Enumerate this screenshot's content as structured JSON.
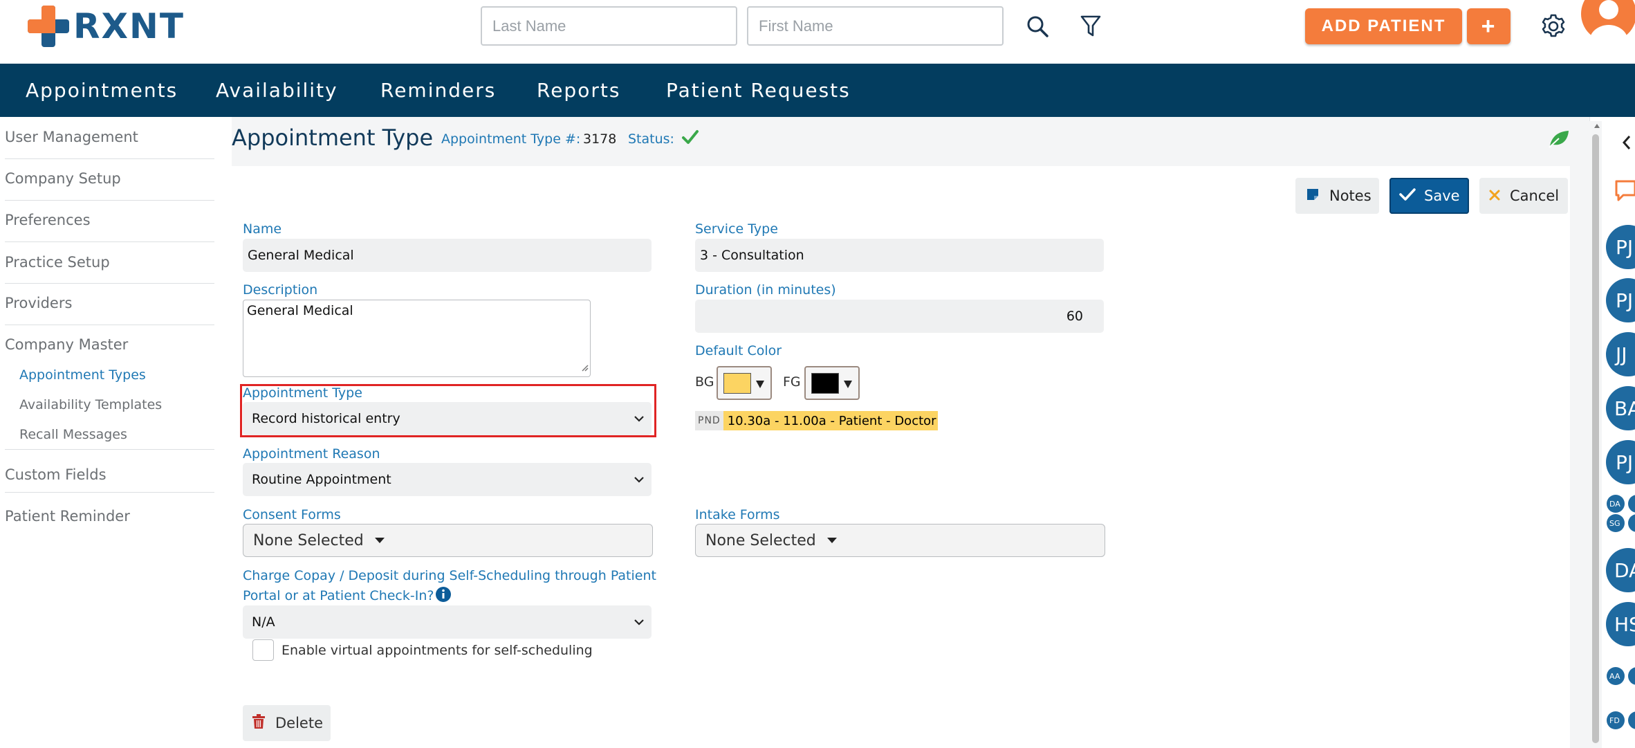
{
  "app": {
    "logo_text": "RXNT"
  },
  "search": {
    "last_name_placeholder": "Last Name",
    "first_name_placeholder": "First Name"
  },
  "topbar": {
    "add_patient_label": "ADD PATIENT",
    "plus_label": "+"
  },
  "nav": {
    "items": [
      "Appointments",
      "Availability",
      "Reminders",
      "Reports",
      "Patient Requests"
    ]
  },
  "sidebar": {
    "items": [
      "User Management",
      "Company Setup",
      "Preferences",
      "Practice Setup",
      "Providers",
      "Company Master"
    ],
    "subitems": [
      "Appointment Types",
      "Availability Templates",
      "Recall Messages"
    ],
    "active_subitem": "Appointment Types",
    "more_items": [
      "Custom Fields",
      "Patient Reminder"
    ]
  },
  "page": {
    "title": "Appointment Type",
    "type_number_label": "Appointment Type #:",
    "type_number_value": "3178",
    "status_label": "Status:"
  },
  "actions": {
    "notes": "Notes",
    "save": "Save",
    "cancel": "Cancel",
    "delete": "Delete"
  },
  "form": {
    "name_label": "Name",
    "name_value": "General Medical",
    "description_label": "Description",
    "description_value": "General Medical",
    "appointment_type_label": "Appointment Type",
    "appointment_type_value": "Record historical entry",
    "appointment_reason_label": "Appointment Reason",
    "appointment_reason_value": "Routine Appointment",
    "consent_forms_label": "Consent Forms",
    "consent_forms_value": "None Selected",
    "charge_copay_label_line1": "Charge Copay / Deposit during Self-Scheduling through Patient",
    "charge_copay_label_line2": "Portal or at Patient Check-In?",
    "charge_copay_value": "N/A",
    "virtual_checkbox_label": "Enable virtual appointments for self-scheduling",
    "service_type_label": "Service Type",
    "service_type_value": "3 - Consultation",
    "duration_label": "Duration (in minutes)",
    "duration_value": "60",
    "default_color_label": "Default Color",
    "bg_label": "BG",
    "fg_label": "FG",
    "bg_color": "#fcd462",
    "fg_color": "#000000",
    "preview_badge": "PND",
    "preview_text": "10.30a - 11.00a - Patient - Doctor",
    "intake_forms_label": "Intake Forms",
    "intake_forms_value": "None Selected"
  },
  "rail": {
    "avatars": [
      "PJ",
      "PJ",
      "JJ",
      "BA",
      "PJ",
      "DA",
      "HS"
    ],
    "small_avatars": [
      "DA",
      "SG",
      "AA",
      "FD"
    ]
  },
  "colors": {
    "accent": "#1f78b4",
    "nav_bg": "#033d5f",
    "orange": "#f47c3c",
    "save_bg": "#0c5c99",
    "highlight_border": "#e02424"
  }
}
